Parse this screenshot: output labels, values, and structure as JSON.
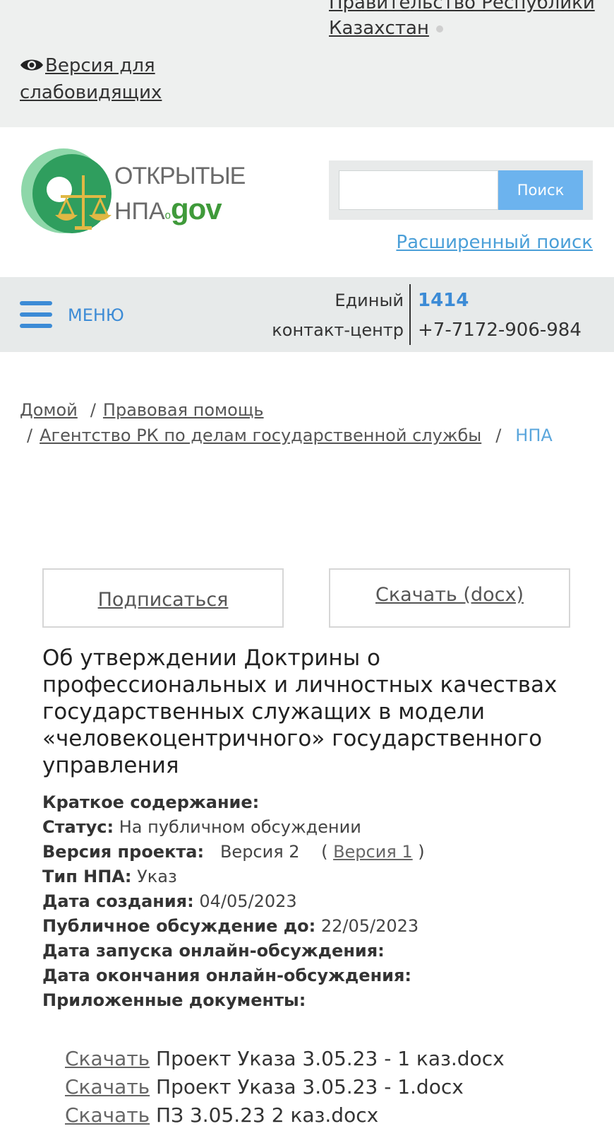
{
  "top": {
    "gov_link_line1": "Правительство Республики",
    "gov_link_line2": "Казахстан",
    "vision_line1": "Версия для",
    "vision_line2": "слабовидящих"
  },
  "header": {
    "logo_line1": "ОТКРЫТЫЕ",
    "logo_npa": "НПА",
    "logo_gov": "gov",
    "search_placeholder": "",
    "search_button": "Поиск",
    "advanced_search": "Расширенный поиск"
  },
  "menu_bar": {
    "menu_label": "МЕНЮ",
    "contact_line1": "Единый",
    "contact_line2": "контакт-центр",
    "phone_short": "1414",
    "phone_long": "+7-7172-906-984"
  },
  "breadcrumb": {
    "items": [
      "Домой",
      "Правовая помощь",
      "Агентство РК по делам государственной службы"
    ],
    "current": "НПА",
    "separator": "/"
  },
  "actions": {
    "subscribe": "Подписаться",
    "download": "Скачать (docx)"
  },
  "document": {
    "title": "Об утверждении Доктрины о профессиональных и личностных качествах государственных служащих в модели «человекоцентричного» государственного управления",
    "summary_label": "Краткое содержание:",
    "status_label": "Статус:",
    "status_value": "На публичном обсуждении",
    "version_label": "Версия проекта:",
    "version_current": "Версия 2",
    "version_prev": "Версия 1",
    "type_label": "Тип НПА:",
    "type_value": "Указ",
    "created_label": "Дата создания:",
    "created_value": "04/05/2023",
    "discussion_label": "Публичное обсуждение до:",
    "discussion_value": "22/05/2023",
    "online_start_label": "Дата запуска онлайн-обсуждения:",
    "online_end_label": "Дата окончания онлайн-обсуждения:",
    "attachments_label": "Приложенные документы:"
  },
  "attachments": {
    "link_label": "Скачать",
    "files": [
      "Проект Указа 3.05.23 - 1 каз.docx",
      "Проект Указа 3.05.23 - 1.docx",
      "ПЗ 3.05.23 2 каз.docx"
    ]
  },
  "colors": {
    "accent_blue": "#3c8bd6",
    "search_button": "#6cb3ee",
    "logo_green": "#3f9a3a",
    "top_bar_bg": "#eef0ef"
  }
}
